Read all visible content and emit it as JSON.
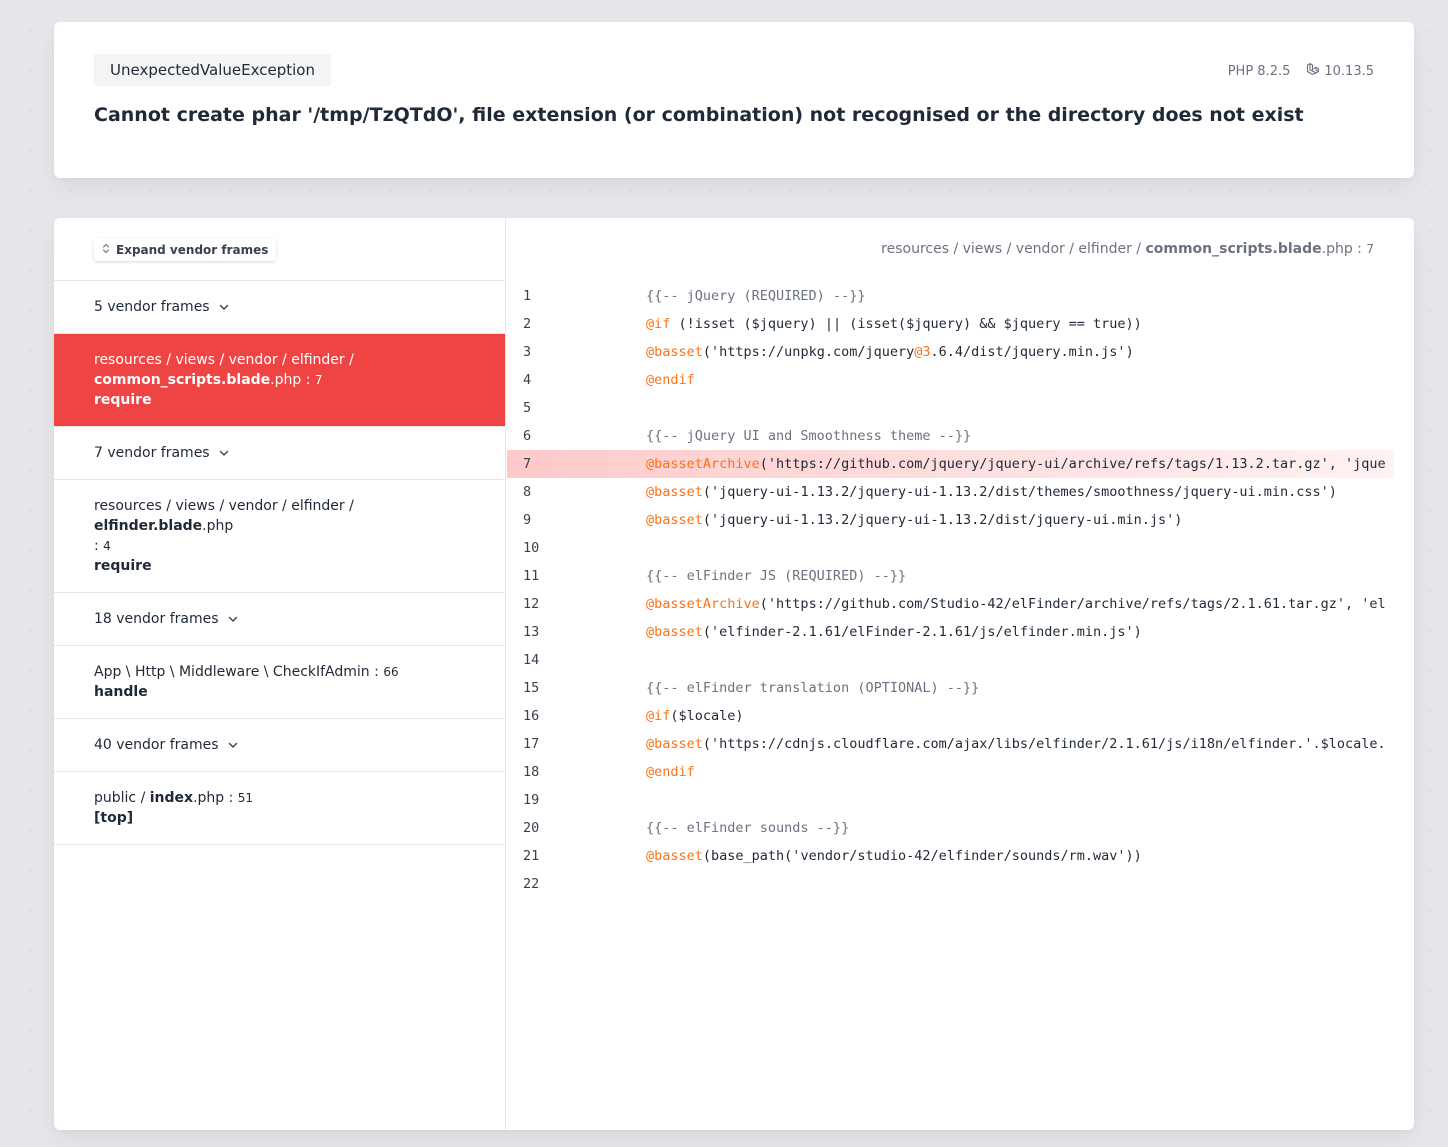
{
  "header": {
    "exception_class": "UnexpectedValueException",
    "message": "Cannot create phar '/tmp/TzQTdO', file extension (or combination) not recognised or the directory does not exist",
    "php_version": "PHP 8.2.5",
    "laravel_version": "10.13.5"
  },
  "frames_panel": {
    "expand_label": "Expand vendor frames",
    "vendor_groups": [
      "5 vendor frames",
      "7 vendor frames",
      "18 vendor frames",
      "40 vendor frames"
    ],
    "app_frames": [
      {
        "dir": "resources / views / vendor / elfinder /",
        "file": "common_scripts.blade",
        "ext": ".php",
        "sep": " : ",
        "line": "7",
        "function": "require"
      },
      {
        "dir": "resources / views / vendor / elfinder / ",
        "file": "elfinder.blade",
        "ext": ".php",
        "sep": ": ",
        "line": "4",
        "function": "require"
      },
      {
        "dir": "App \\ Http \\ Middleware \\ CheckIfAdmin",
        "file": "",
        "ext": "",
        "sep": " : ",
        "line": "66",
        "function": "handle"
      },
      {
        "dir": "public / ",
        "file": "index",
        "ext": ".php",
        "sep": " : ",
        "line": "51",
        "function": "[top]"
      }
    ]
  },
  "code_panel": {
    "path_dir": "resources / views / vendor / elfinder / ",
    "path_file": "common_scripts.blade",
    "path_ext": ".php",
    "path_sep": " : ",
    "path_line": "7",
    "highlight_line": 7,
    "lines": [
      {
        "num": "1",
        "parts": [
          {
            "t": "cmt",
            "v": "{{-- jQuery (REQUIRED) --}}"
          }
        ]
      },
      {
        "num": "2",
        "parts": [
          {
            "t": "dir",
            "v": "@if"
          },
          {
            "t": "txt",
            "v": " (!isset ($jquery) || (isset($jquery) && $jquery == true))"
          }
        ]
      },
      {
        "num": "3",
        "parts": [
          {
            "t": "dir",
            "v": "@basset"
          },
          {
            "t": "txt",
            "v": "('https://unpkg.com/jquery"
          },
          {
            "t": "dir",
            "v": "@3"
          },
          {
            "t": "txt",
            "v": ".6.4/dist/jquery.min.js')"
          }
        ]
      },
      {
        "num": "4",
        "parts": [
          {
            "t": "dir",
            "v": "@endif"
          }
        ]
      },
      {
        "num": "5",
        "parts": []
      },
      {
        "num": "6",
        "parts": [
          {
            "t": "cmt",
            "v": "{{-- jQuery UI and Smoothness theme --}}"
          }
        ]
      },
      {
        "num": "7",
        "parts": [
          {
            "t": "dir",
            "v": "@bassetArchive"
          },
          {
            "t": "txt",
            "v": "('https://github.com/jquery/jquery-ui/archive/refs/tags/1.13.2.tar.gz', 'jque"
          }
        ]
      },
      {
        "num": "8",
        "parts": [
          {
            "t": "dir",
            "v": "@basset"
          },
          {
            "t": "txt",
            "v": "('jquery-ui-1.13.2/jquery-ui-1.13.2/dist/themes/smoothness/jquery-ui.min.css')"
          }
        ]
      },
      {
        "num": "9",
        "parts": [
          {
            "t": "dir",
            "v": "@basset"
          },
          {
            "t": "txt",
            "v": "('jquery-ui-1.13.2/jquery-ui-1.13.2/dist/jquery-ui.min.js')"
          }
        ]
      },
      {
        "num": "10",
        "parts": []
      },
      {
        "num": "11",
        "parts": [
          {
            "t": "cmt",
            "v": "{{-- elFinder JS (REQUIRED) --}}"
          }
        ]
      },
      {
        "num": "12",
        "parts": [
          {
            "t": "dir",
            "v": "@bassetArchive"
          },
          {
            "t": "txt",
            "v": "('https://github.com/Studio-42/elFinder/archive/refs/tags/2.1.61.tar.gz', 'el"
          }
        ]
      },
      {
        "num": "13",
        "parts": [
          {
            "t": "dir",
            "v": "@basset"
          },
          {
            "t": "txt",
            "v": "('elfinder-2.1.61/elFinder-2.1.61/js/elfinder.min.js')"
          }
        ]
      },
      {
        "num": "14",
        "parts": []
      },
      {
        "num": "15",
        "parts": [
          {
            "t": "cmt",
            "v": "{{-- elFinder translation (OPTIONAL) --}}"
          }
        ]
      },
      {
        "num": "16",
        "parts": [
          {
            "t": "dir",
            "v": "@if"
          },
          {
            "t": "txt",
            "v": "($locale)"
          }
        ]
      },
      {
        "num": "17",
        "parts": [
          {
            "t": "dir",
            "v": "@basset"
          },
          {
            "t": "txt",
            "v": "('https://cdnjs.cloudflare.com/ajax/libs/elfinder/2.1.61/js/i18n/elfinder.'.$locale."
          }
        ]
      },
      {
        "num": "18",
        "parts": [
          {
            "t": "dir",
            "v": "@endif"
          }
        ]
      },
      {
        "num": "19",
        "parts": []
      },
      {
        "num": "20",
        "parts": [
          {
            "t": "cmt",
            "v": "{{-- elFinder sounds --}}"
          }
        ]
      },
      {
        "num": "21",
        "parts": [
          {
            "t": "dir",
            "v": "@basset"
          },
          {
            "t": "txt",
            "v": "(base_path('vendor/studio-42/elfinder/sounds/rm.wav'))"
          }
        ]
      },
      {
        "num": "22",
        "parts": []
      }
    ]
  },
  "colors": {
    "accent_red": "#ef4444",
    "directive_orange": "#f97316",
    "comment_gray": "#6b7280",
    "highlight_bg": "#fecaca"
  }
}
